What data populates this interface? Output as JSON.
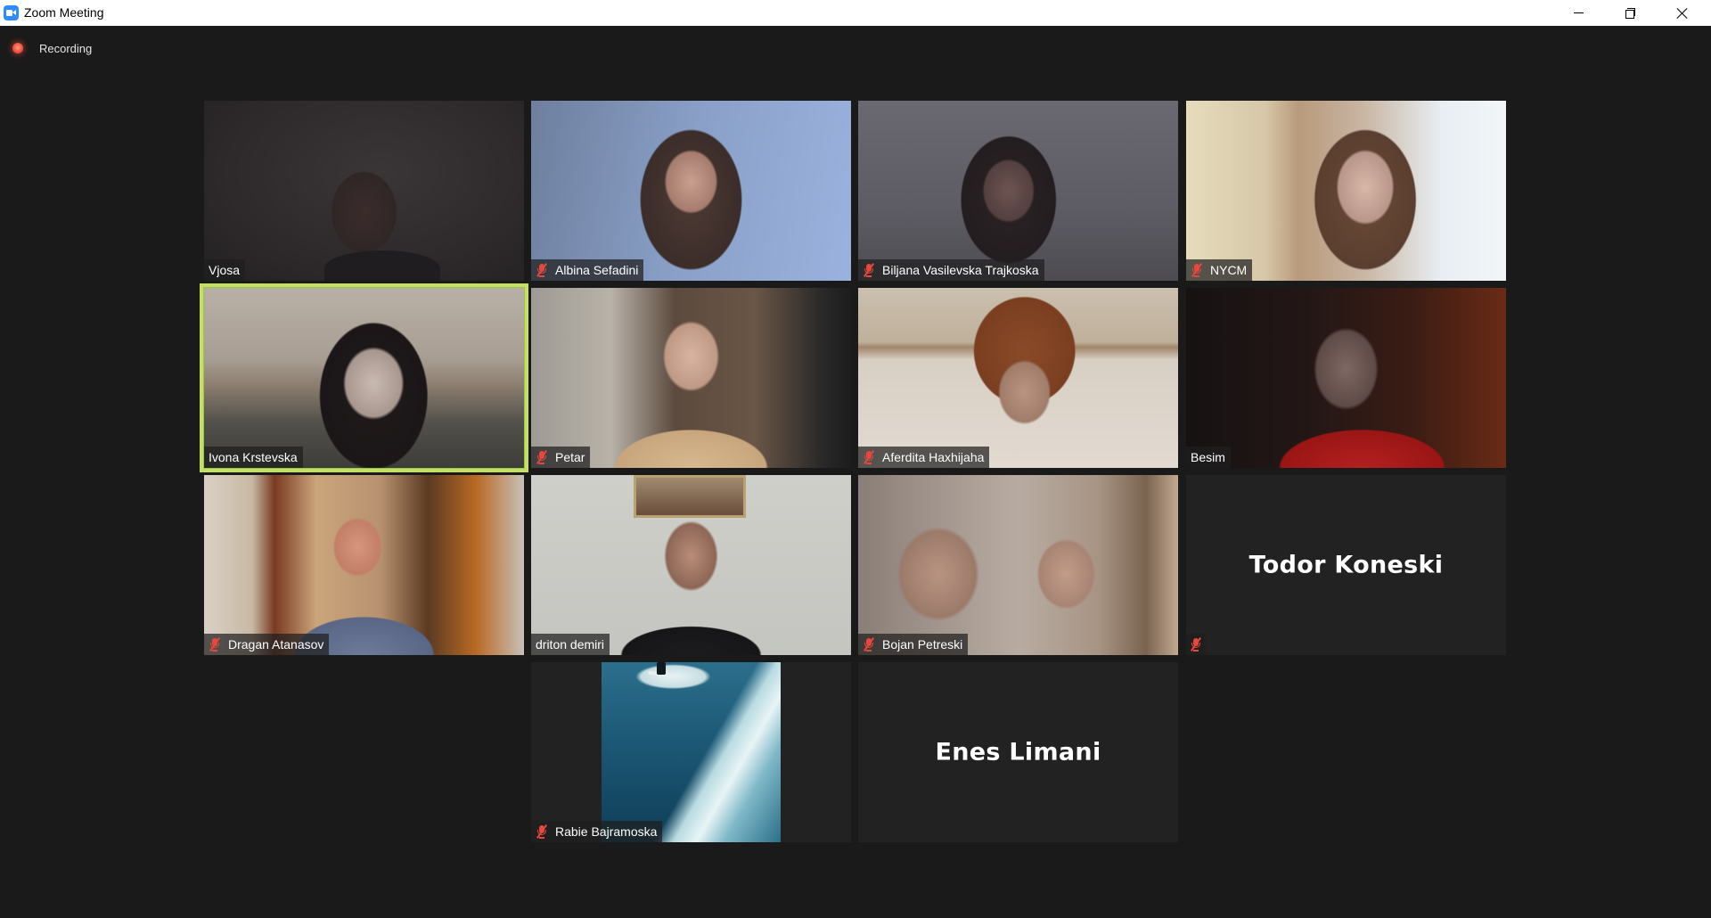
{
  "window": {
    "title": "Zoom Meeting",
    "controls": {
      "minimize": "minimize-icon",
      "maximize": "restore-icon",
      "close": "close-icon"
    }
  },
  "recording": {
    "label": "Recording",
    "indicator_color": "#f0533c"
  },
  "colors": {
    "background": "#1a1a1a",
    "tile_background": "#222222",
    "active_speaker_border": "#c6dd6a",
    "muted_icon": "#e8473e"
  },
  "participants": [
    {
      "name": "Vjosa",
      "muted": false,
      "video": true
    },
    {
      "name": "Albina Sefadini",
      "muted": true,
      "video": true
    },
    {
      "name": "Biljana Vasilevska Trajkoska",
      "muted": true,
      "video": true
    },
    {
      "name": "NYCM",
      "muted": true,
      "video": true
    },
    {
      "name": "Ivona Krstevska",
      "muted": false,
      "video": true,
      "active_speaker": true
    },
    {
      "name": "Petar",
      "muted": true,
      "video": true
    },
    {
      "name": "Aferdita Haxhijaha",
      "muted": true,
      "video": true
    },
    {
      "name": "Besim",
      "muted": false,
      "video": true
    },
    {
      "name": "Dragan Atanasov",
      "muted": true,
      "video": true
    },
    {
      "name": "driton demiri",
      "muted": false,
      "video": true
    },
    {
      "name": "Bojan Petreski",
      "muted": true,
      "video": true
    },
    {
      "name": "Todor Koneski",
      "muted": true,
      "video": false
    },
    {
      "name": "Rabie Bajramoska",
      "muted": true,
      "video": true
    },
    {
      "name": "Enes Limani",
      "muted": false,
      "video": false
    }
  ]
}
